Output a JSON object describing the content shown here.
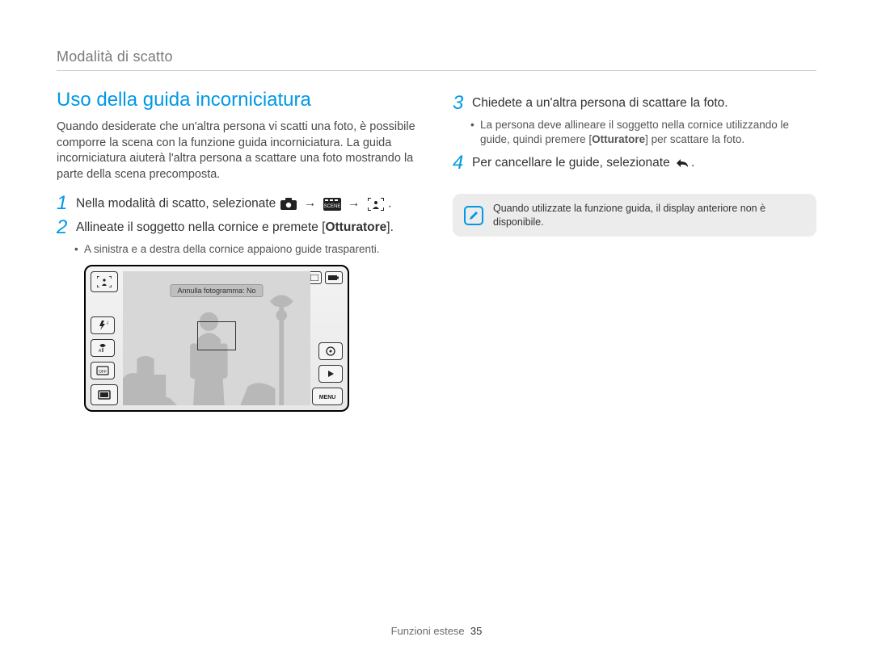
{
  "breadcrumb": "Modalità di scatto",
  "title": "Uso della guida incorniciatura",
  "intro": "Quando desiderate che un'altra persona vi scatti una foto, è possibile comporre la scena con la funzione guida incorniciatura. La guida incorniciatura aiuterà l'altra persona a scattare una foto mostrando la parte della scena precomposta.",
  "steps": {
    "s1": {
      "num": "1",
      "text_before": "Nella modalità di scatto, selezionate ",
      "arrow": "→",
      "period": "."
    },
    "s2": {
      "num": "2",
      "text_before": "Allineate il soggetto nella cornice e premete [",
      "bold": "Otturatore",
      "text_after": "].",
      "sub": "A sinistra e a destra della cornice appaiono guide trasparenti."
    },
    "s3": {
      "num": "3",
      "text": "Chiedete a un'altra persona di scattare la foto.",
      "sub_before": "La persona deve allineare il soggetto nella cornice utilizzando le guide, quindi premere [",
      "sub_bold": "Otturatore",
      "sub_after": "] per scattare la foto."
    },
    "s4": {
      "num": "4",
      "text_before": "Per cancellare le guide, selezionate ",
      "period": "."
    }
  },
  "note": "Quando utilizzate la funzione guida, il display anteriore non è disponibile.",
  "camera_label": "Annulla fotogramma: No",
  "footer": {
    "label": "Funzioni estese",
    "page": "35"
  },
  "icon_names": {
    "camera": "camera-icon",
    "scene": "scene-icon",
    "frame": "frame-guide-icon",
    "back": "return-icon",
    "pencil": "pencil-icon"
  }
}
